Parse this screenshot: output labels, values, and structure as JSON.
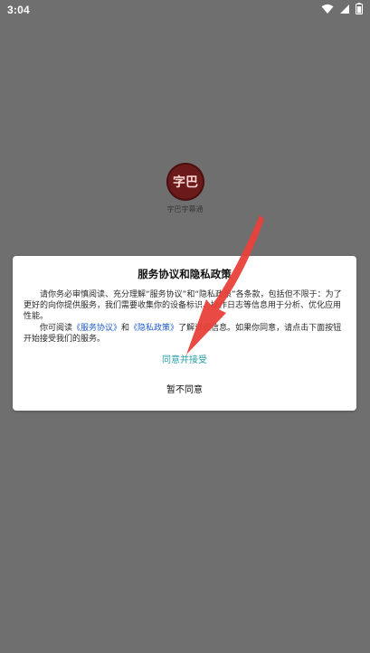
{
  "status_bar": {
    "time": "3:04",
    "icons": [
      "wifi-icon",
      "cellular-signal-icon",
      "battery-icon"
    ]
  },
  "splash": {
    "logo_text": "字巴",
    "app_name": "字巴字幕通"
  },
  "dialog": {
    "title": "服务协议和隐私政策",
    "paragraph1": "请你务必审慎阅读、充分理解“服务协议”和“隐私政策”各条款，包括但不限于：为了更好的向你提供服务，我们需要收集你的设备标识、操作日志等信息用于分析、优化应用性能。",
    "paragraph2_prefix": "你可阅读",
    "service_link": "《服务协议》",
    "paragraph2_and": "和",
    "privacy_link": "《隐私政策》",
    "paragraph2_suffix": "了解详细信息。如果你同意，请点击下面按钮开始接受我们的服务。",
    "agree_label": "同意并接受",
    "disagree_label": "暂不同意"
  },
  "colors": {
    "overlay": "#6f6f6f",
    "dialog_bg": "#ffffff",
    "agree": "#2aa0a8",
    "link": "#1e5bc8",
    "annotation_arrow": "#e8413a",
    "logo": "#6b1a1a"
  },
  "annotation": {
    "icon": "red-arrow-annotation",
    "points_to": "agree-button"
  }
}
